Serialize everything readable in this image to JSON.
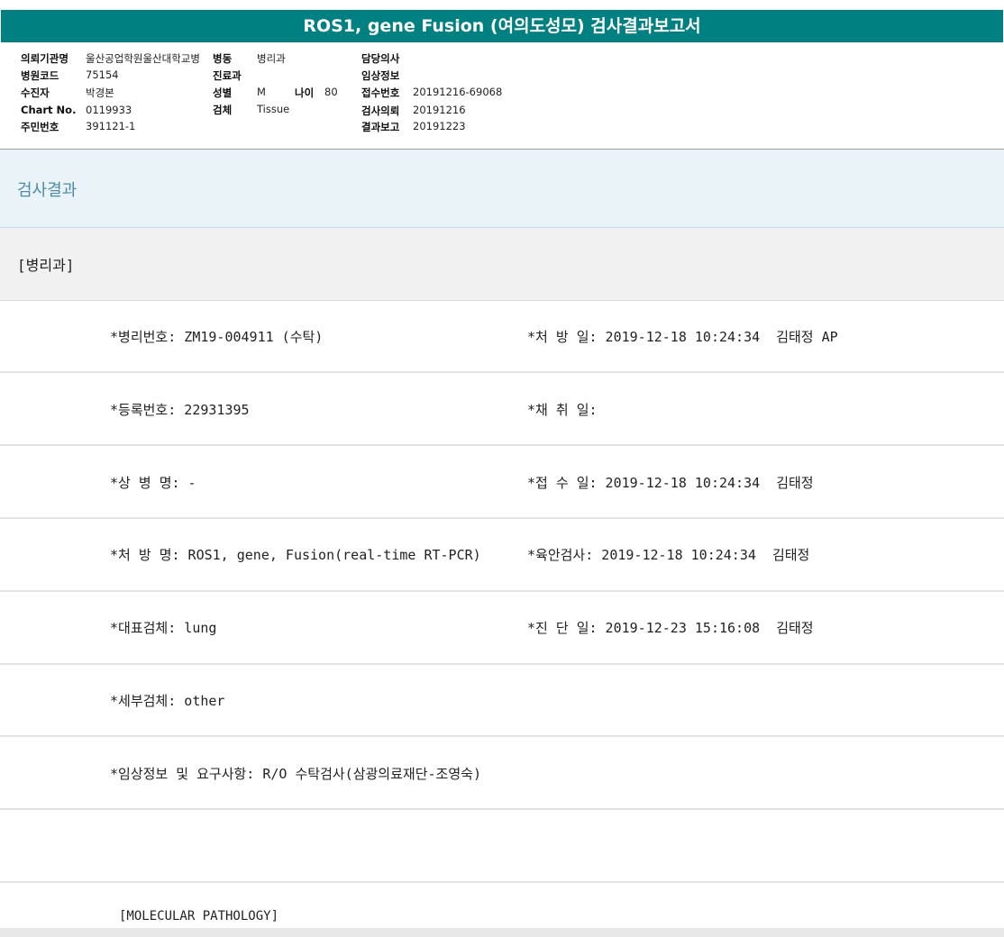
{
  "title": "ROS1, gene Fusion (여의도성모) 검사결과보고서",
  "header": {
    "institution_label": "의뢰기관명",
    "institution_value": "울산공업학원울산대학교병",
    "ward_label": "병동",
    "ward_value": "병리과",
    "doctor_label": "담당의사",
    "hospital_code_label": "병원코드",
    "hospital_code_value": "75154",
    "dept_label": "진료과",
    "clinical_info_label": "임상정보",
    "patient_label": "수진자",
    "patient_value": "박경본",
    "sex_label": "성별",
    "sex_value": "M",
    "age_label": "나이",
    "age_value": "80",
    "receipt_no_label": "접수번호",
    "receipt_no_value": "20191216-69068",
    "chart_label": "Chart No.",
    "chart_value": "0119933",
    "specimen_label": "검체",
    "specimen_value": "Tissue",
    "request_label": "검사의뢰",
    "request_value": "20191216",
    "id_label": "주민번호",
    "id_value": "391121-1",
    "report_label": "결과보고",
    "report_value": "20191223"
  },
  "section_title": "검사결과",
  "dept_title": "[병리과]",
  "rows": {
    "r1_left": "*병리번호: ZM19-004911 (수탁)",
    "r1_right": "*처 방 일: 2019-12-18 10:24:34  김태정 AP",
    "r2_left": "*등록번호: 22931395",
    "r2_right": "*채 취 일:",
    "r3_left": "*상 병 명: -",
    "r3_right": "*접 수 일: 2019-12-18 10:24:34  김태정",
    "r4_left": "*처 방 명: ROS1, gene, Fusion(real-time RT-PCR)",
    "r4_right": "*육안검사: 2019-12-18 10:24:34  김태정",
    "r5_left": "*대표검체: lung",
    "r5_right": "*진 단 일: 2019-12-23 15:16:08  김태정",
    "r6_left": "*세부검체: other",
    "r7_left": "*임상정보 및 요구사항: R/O 수탁검사(삼광의료재단-조영숙)",
    "r8_left": "[MOLECULAR PATHOLOGY]"
  }
}
